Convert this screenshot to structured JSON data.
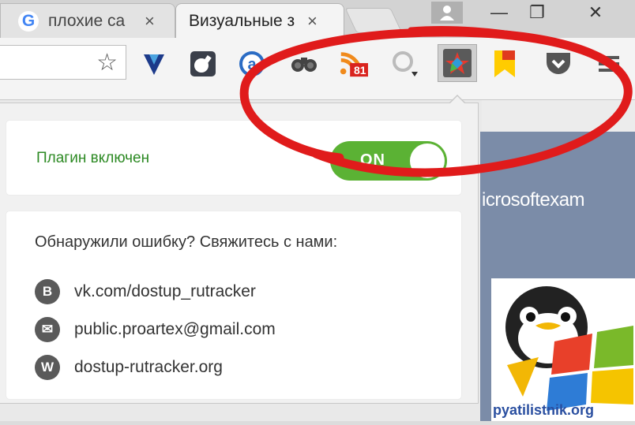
{
  "tabs": [
    {
      "title": "плохие са",
      "close": "×",
      "active": false
    },
    {
      "title": "Визуальные з",
      "close": "×",
      "active": true
    }
  ],
  "window": {
    "minimize": "—",
    "maximize": "❐",
    "close": "✕"
  },
  "toolbar": {
    "bookmark_icon": "star-icon",
    "extensions": [
      "yandex-icon",
      "bomb-icon",
      "a-icon",
      "binoculars-icon",
      "rss-icon",
      "search-icon",
      "frigate-icon",
      "bookmark-flag-icon",
      "pocket-icon",
      "menu-icon"
    ],
    "rss_badge": "81"
  },
  "popup": {
    "toggle_label": "Плагин включен",
    "toggle_state": "ON",
    "contact_heading": "Обнаружили ошибку? Свяжитесь с нами:",
    "contacts": [
      {
        "icon": "vk-icon",
        "glyph": "В",
        "text": "vk.com/dostup_rutracker"
      },
      {
        "icon": "mail-icon",
        "glyph": "✉",
        "text": "public.proartex@gmail.com"
      },
      {
        "icon": "web-icon",
        "glyph": "W",
        "text": "dostup-rutracker.org"
      }
    ]
  },
  "site": {
    "text": "icrosoftexam",
    "watermark": "pyatilistnik.org"
  },
  "colors": {
    "toggle_on": "#5bb234",
    "label_green": "#2d8a24",
    "annotation_red": "#e01b1b"
  }
}
